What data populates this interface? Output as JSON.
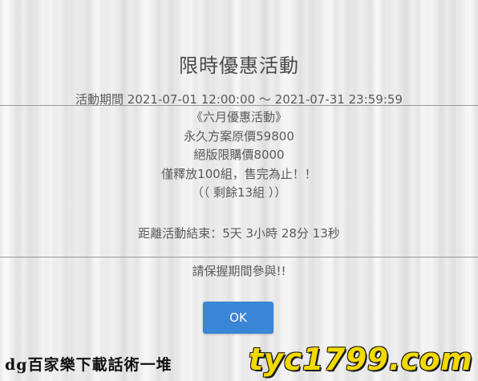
{
  "dialog": {
    "title": "限時優惠活動",
    "period": "活動期間 2021-07-01 12:00:00 ～ 2021-07-31 23:59:59",
    "lines": [
      "《六月優惠活動》",
      "永久方案原價59800",
      "絕版限購價8000",
      "僅釋放100組，售完為止！！",
      "（（ 剩餘13組 ））"
    ],
    "countdown": "距離活動結束：5天 3小時 28分 13秒",
    "notice": "請保握期間參與!!",
    "ok_label": "OK"
  },
  "footer": {
    "left_text": "dg百家樂下載話術一堆",
    "right_text": "tyc1799.com"
  },
  "colors": {
    "button": "#3b85d6",
    "watermark": "#f2d900"
  }
}
